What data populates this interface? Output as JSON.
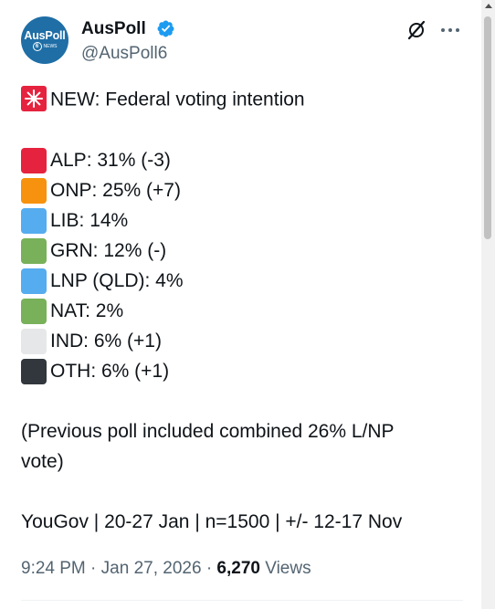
{
  "author": {
    "display_name": "AusPoll",
    "handle": "@AusPoll6",
    "avatar_label": "AusPoll",
    "avatar_sub_number": "6",
    "avatar_sub_text": "NEWS",
    "verified_color": "#1d9bf0"
  },
  "tweet": {
    "headline_icon": "rotating-light-emoji",
    "headline": "NEW: Federal voting intention",
    "results": [
      {
        "label": "ALP: 31% (-3)",
        "color": "#e5233f",
        "icon": "red-square-emoji"
      },
      {
        "label": "ONP: 25% (+7)",
        "color": "#f7920e",
        "icon": "orange-square-emoji"
      },
      {
        "label": "LIB: 14%",
        "color": "#55acee",
        "icon": "blue-square-emoji"
      },
      {
        "label": "GRN: 12% (-)",
        "color": "#78b159",
        "icon": "green-square-emoji"
      },
      {
        "label": "LNP (QLD): 4%",
        "color": "#55acee",
        "icon": "blue-square-emoji"
      },
      {
        "label": "NAT: 2%",
        "color": "#78b159",
        "icon": "green-square-emoji"
      },
      {
        "label": "IND: 6% (+1)",
        "color": "#e6e7e8",
        "icon": "white-square-emoji"
      },
      {
        "label": "OTH: 6% (+1)",
        "color": "#31373d",
        "icon": "black-square-emoji"
      }
    ],
    "note_line1": "(Previous poll included combined 26% L/NP",
    "note_line2": "vote)",
    "source": "YouGov | 20-27 Jan | n=1500 | +/- 12-17 Nov"
  },
  "meta": {
    "time": "9:24 PM",
    "separator": "·",
    "date": "Jan 27, 2026",
    "views_count": "6,270",
    "views_label": "Views"
  }
}
